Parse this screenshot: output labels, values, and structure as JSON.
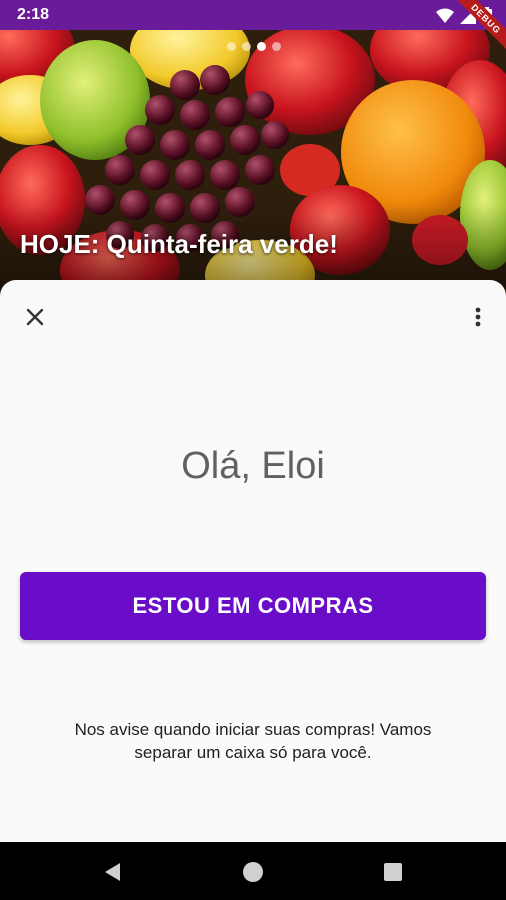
{
  "status_bar": {
    "time": "2:18",
    "debug_label": "DEBUG",
    "icons": [
      "wifi-icon",
      "cellular-icon",
      "battery-icon"
    ]
  },
  "hero": {
    "title": "HOJE: Quinta-feira verde!",
    "carousel_total": 4,
    "carousel_active": 3
  },
  "sheet": {
    "greeting": "Olá, Eloi",
    "primary_button": "ESTOU EM COMPRAS",
    "hint": "Nos avise quando iniciar suas compras! Vamos\nseparar um caixa só para você."
  },
  "nav_bar": {
    "icons": [
      "back-icon",
      "home-icon",
      "recents-icon"
    ]
  },
  "colors": {
    "status_bar": "#6a1b9a",
    "primary": "#6a0dc8",
    "sheet_bg": "#fafafa",
    "greeting_text": "#616161"
  }
}
